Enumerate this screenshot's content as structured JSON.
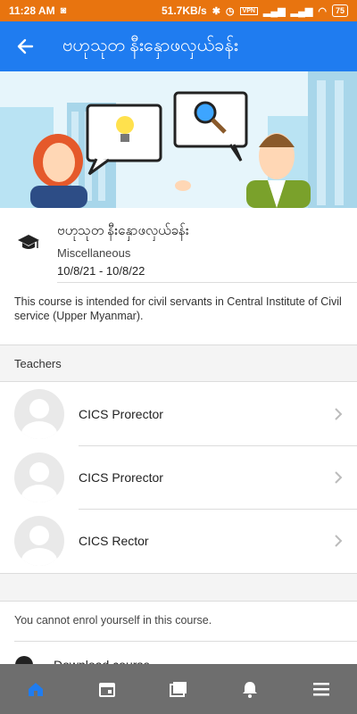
{
  "status_bar": {
    "time": "11:28 AM",
    "speed": "51.7KB/s",
    "battery": "75",
    "vpn": "VPN"
  },
  "app_bar": {
    "title": "ဗဟုသုတ နီးနှောဖလှယ်ခန်း"
  },
  "course": {
    "title": "ဗဟုသုတ နီးနှောဖလှယ်ခန်း",
    "category": "Miscellaneous",
    "dates": "10/8/21 - 10/8/22",
    "summary": "This course is intended for civil servants in Central Institute of Civil service (Upper Myanmar)."
  },
  "teachers": {
    "heading": "Teachers",
    "items": [
      {
        "name": "CICS Prorector"
      },
      {
        "name": "CICS Prorector"
      },
      {
        "name": "CICS Rector"
      }
    ]
  },
  "enrol": {
    "notice": "You cannot enrol yourself in this course.",
    "download_label": "Download course"
  },
  "colors": {
    "status_bar": "#e8740f",
    "app_bar": "#1f7cf0",
    "bottom_nav": "#6e6e6e",
    "active_nav": "#1f7cf0"
  },
  "bottom_nav": {
    "items": [
      {
        "icon": "home-icon",
        "active": true
      },
      {
        "icon": "calendar-icon",
        "active": false
      },
      {
        "icon": "courses-icon",
        "active": false
      },
      {
        "icon": "bell-icon",
        "active": false
      },
      {
        "icon": "menu-icon",
        "active": false
      }
    ]
  }
}
